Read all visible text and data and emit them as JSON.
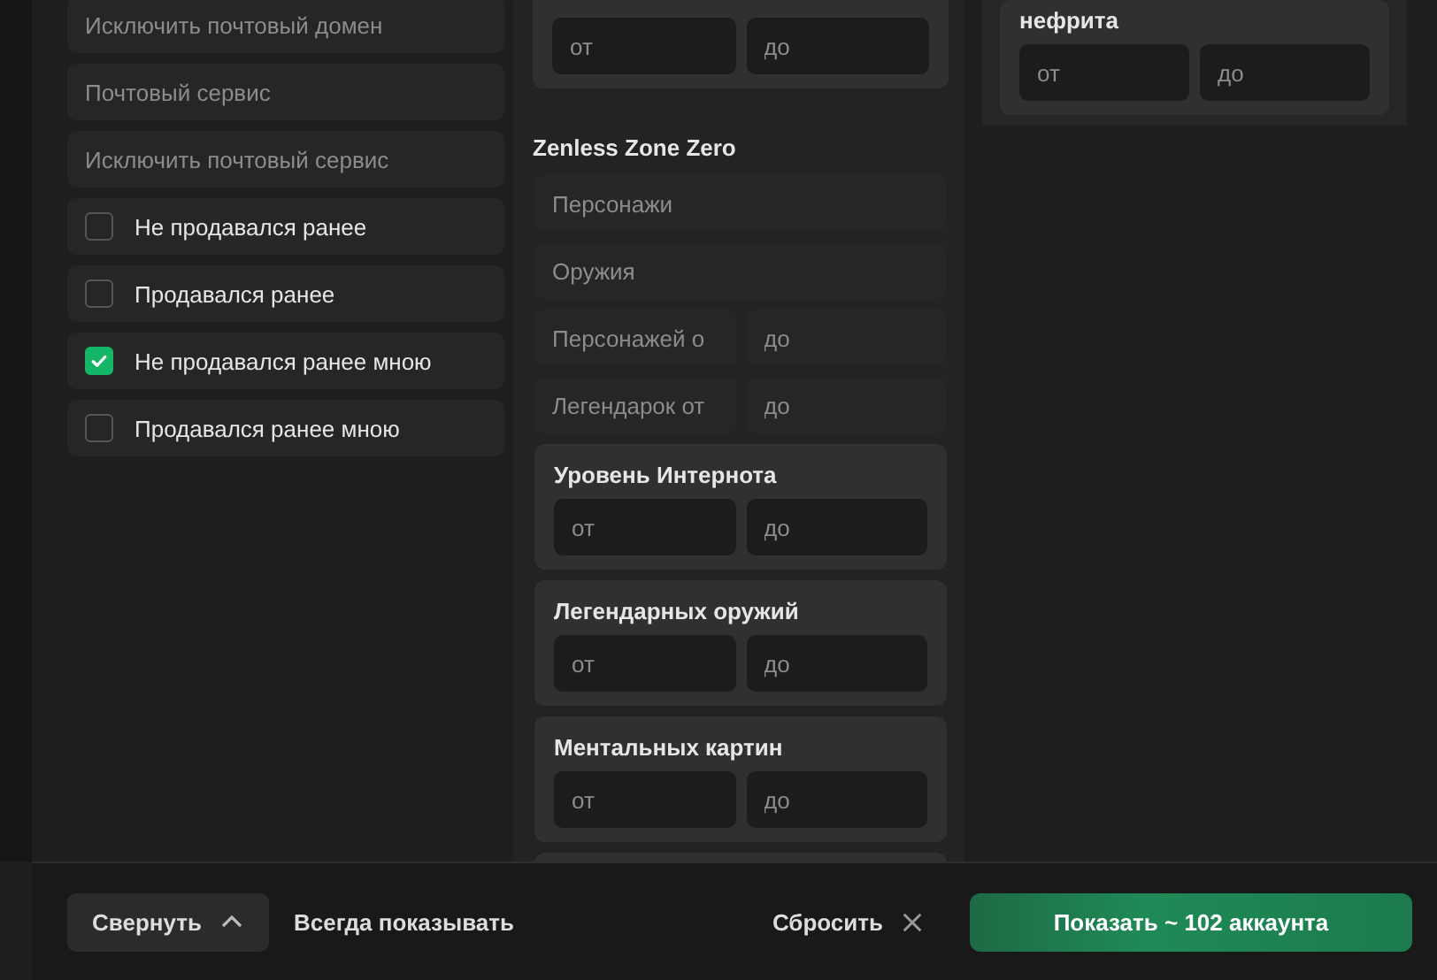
{
  "left": {
    "fields": [
      {
        "placeholder": "Исключить почтовый домен"
      },
      {
        "placeholder": "Почтовый сервис"
      },
      {
        "placeholder": "Исключить почтовый сервис"
      }
    ],
    "checkboxes": [
      {
        "label": "Не продавался ранее",
        "checked": false
      },
      {
        "label": "Продавался ранее",
        "checked": false
      },
      {
        "label": "Не продавался ранее мною",
        "checked": true
      },
      {
        "label": "Продавался ранее мною",
        "checked": false
      }
    ]
  },
  "middle": {
    "top_range": {
      "from_placeholder": "от",
      "to_placeholder": "до"
    },
    "section": {
      "title": "Zenless Zone Zero",
      "fields": [
        {
          "placeholder": "Персонажи"
        },
        {
          "placeholder": "Оружия"
        }
      ],
      "ranges": [
        {
          "from_placeholder": "Персонажей о",
          "to_placeholder": "до"
        },
        {
          "from_placeholder": "Легендарок от",
          "to_placeholder": "до"
        }
      ],
      "cards": [
        {
          "title": "Уровень Интернота",
          "from_placeholder": "от",
          "to_placeholder": "до"
        },
        {
          "title": "Легендарных оружий",
          "from_placeholder": "от",
          "to_placeholder": "до"
        },
        {
          "title": "Ментальных картин",
          "from_placeholder": "от",
          "to_placeholder": "до"
        }
      ]
    }
  },
  "right": {
    "card": {
      "title": "нефрита",
      "from_placeholder": "от",
      "to_placeholder": "до"
    }
  },
  "footer": {
    "collapse_button": "Свернуть",
    "always_show_link": "Всегда показывать",
    "reset_button": "Сбросить",
    "show_button": "Показать ~ 102 аккаунта"
  }
}
